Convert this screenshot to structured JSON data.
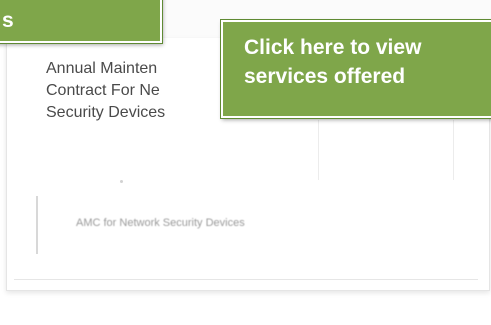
{
  "card": {
    "title": "Annual Mainten\nContract For Ne\nSecurity Devices",
    "link_text": "AMC for Network Security Devices"
  },
  "callouts": {
    "left_text": "s",
    "right_text": "Click here to view\nservices offered"
  },
  "colors": {
    "callout_green": "#7fa64a",
    "title_text": "#4a4a4a",
    "link_text": "#9a9a9a"
  },
  "icons": {
    "link_separator": "ampersand-icon"
  }
}
